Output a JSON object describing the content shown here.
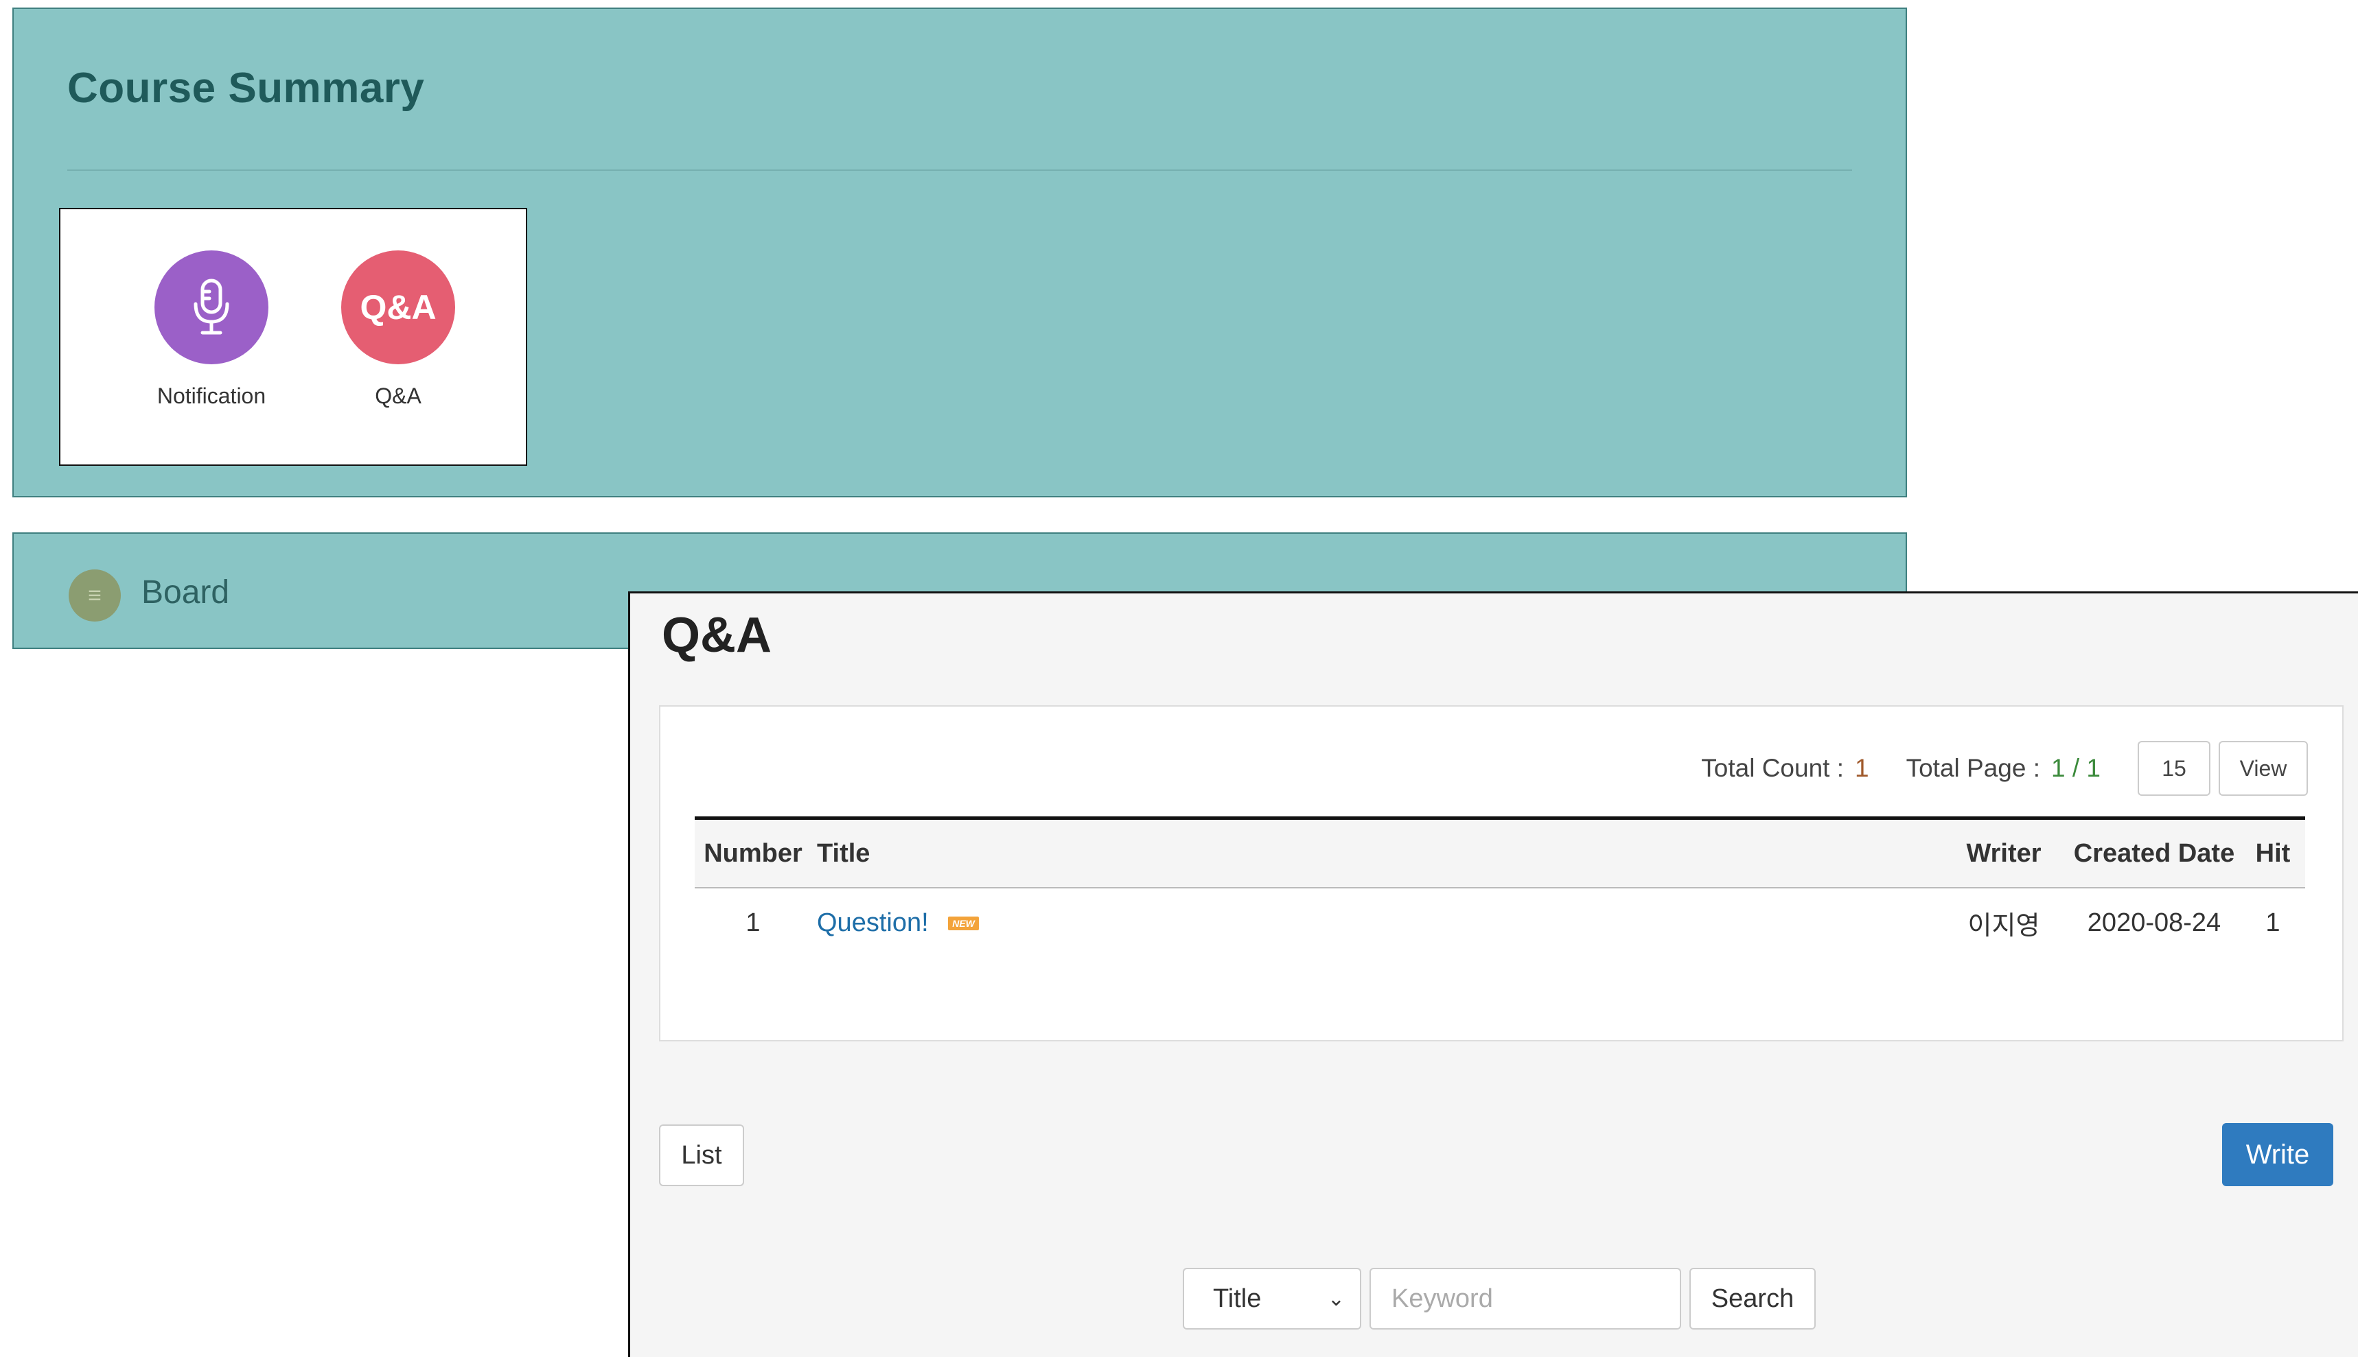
{
  "summary": {
    "title": "Course Summary",
    "icons": [
      {
        "label": "Notification",
        "icon": "microphone-icon",
        "color": "#9b60c8"
      },
      {
        "label": "Q&A",
        "icon_text": "Q&A",
        "color": "#e55e72"
      }
    ]
  },
  "board": {
    "label": "Board",
    "icon": "list-icon"
  },
  "qna": {
    "title": "Q&A",
    "total_count_label": "Total Count :",
    "total_count": "1",
    "total_page_label": "Total Page :",
    "total_page": "1 / 1",
    "per_page": "15",
    "view_label": "View",
    "columns": [
      "Number",
      "Title",
      "Writer",
      "Created Date",
      "Hit"
    ],
    "rows": [
      {
        "number": "1",
        "title": "Question!",
        "badge": "NEW",
        "writer": "이지영",
        "date": "2020-08-24",
        "hit": "1"
      }
    ],
    "list_label": "List",
    "write_label": "Write",
    "search": {
      "field_selected": "Title",
      "keyword_placeholder": "Keyword",
      "search_label": "Search"
    }
  },
  "colors": {
    "panel_bg": "#89c5c5",
    "accent_blue": "#2f7bbf",
    "link": "#1e6ea8",
    "count": "#a05a2c",
    "page": "#3b8a3b"
  }
}
